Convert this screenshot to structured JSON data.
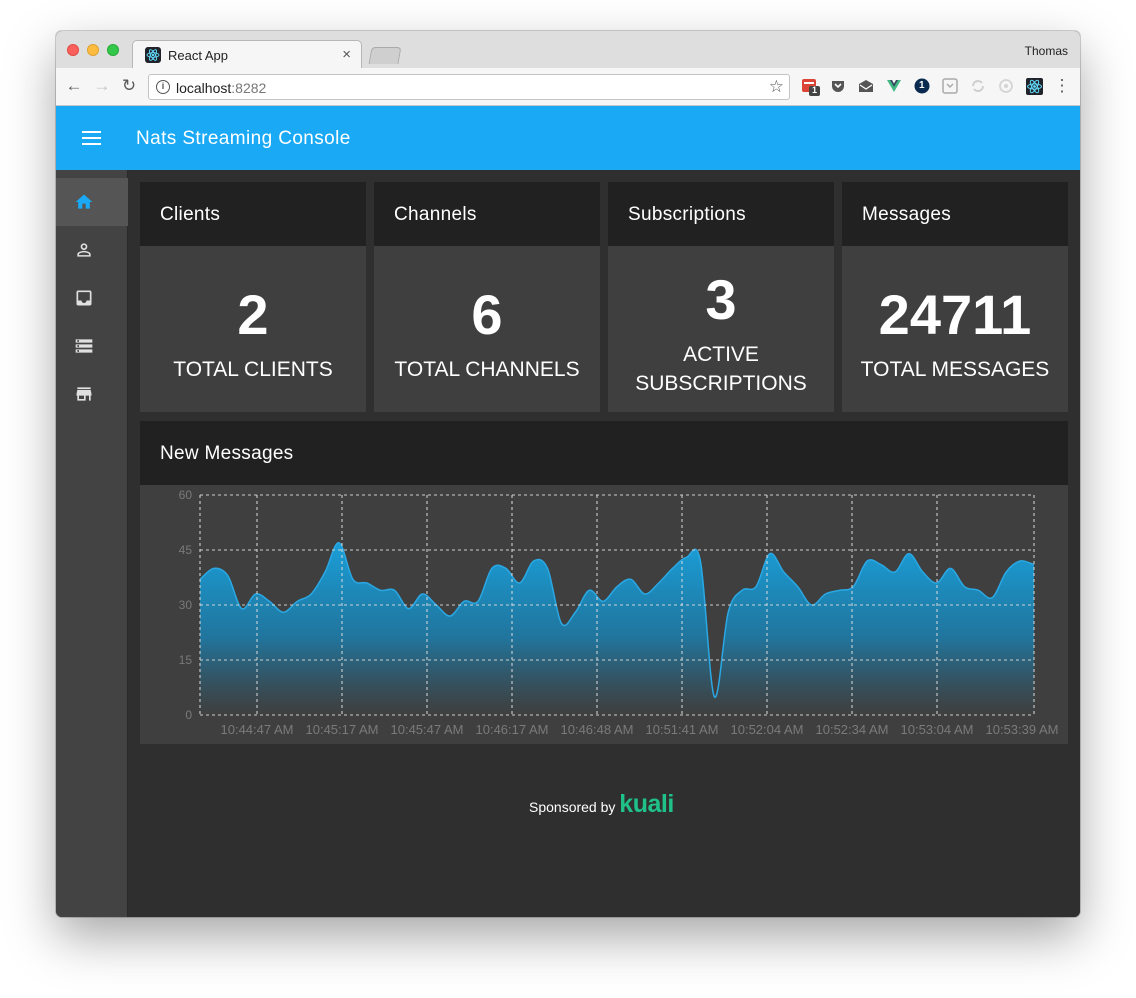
{
  "browser": {
    "tab_title": "React App",
    "tab_close": "×",
    "profile_name": "Thomas",
    "url_host": "localhost",
    "url_port": ":8282",
    "info_glyph": "i",
    "back_glyph": "←",
    "forward_glyph": "→",
    "reload_glyph": "↻",
    "star_glyph": "☆",
    "ext_badge": "1",
    "ext_onepass": "1",
    "ext_menu": "⋮"
  },
  "app": {
    "title": "Nats Streaming Console",
    "accent": "#19a9f5",
    "sidebar": [
      {
        "icon": "home-icon",
        "active": true
      },
      {
        "icon": "person-icon",
        "active": false
      },
      {
        "icon": "inbox-icon",
        "active": false
      },
      {
        "icon": "storage-icon",
        "active": false
      },
      {
        "icon": "store-icon",
        "active": false
      }
    ]
  },
  "cards": [
    {
      "title": "Clients",
      "value": "2",
      "label": "TOTAL CLIENTS"
    },
    {
      "title": "Channels",
      "value": "6",
      "label": "TOTAL CHANNELS"
    },
    {
      "title": "Subscriptions",
      "value": "3",
      "label_line1": "ACTIVE",
      "label_line2": "SUBSCRIPTIONS"
    },
    {
      "title": "Messages",
      "value": "24711",
      "label": "TOTAL MESSAGES"
    }
  ],
  "chart_title": "New Messages",
  "chart_data": {
    "type": "area",
    "ylim": [
      0,
      60
    ],
    "yticks": [
      "0",
      "15",
      "30",
      "45",
      "60"
    ],
    "grid": true,
    "color": "#1a9fd9",
    "xticks": [
      "10:44:47 AM",
      "10:45:17 AM",
      "10:45:47 AM",
      "10:46:17 AM",
      "10:46:48 AM",
      "10:51:41 AM",
      "10:52:04 AM",
      "10:52:34 AM",
      "10:53:04 AM",
      "10:53:39 AM"
    ],
    "values": [
      37,
      40,
      38,
      29,
      33,
      31,
      28,
      31,
      33,
      39,
      47,
      37,
      36,
      34,
      34,
      29,
      33,
      30,
      27,
      31,
      31,
      40,
      40,
      36,
      42,
      40,
      25,
      28,
      34,
      31,
      35,
      37,
      33,
      36,
      40,
      43,
      42,
      5,
      28,
      34,
      35,
      44,
      39,
      35,
      30,
      33,
      34,
      35,
      42,
      41,
      39,
      44,
      39,
      36,
      40,
      35,
      34,
      32,
      39,
      42,
      41
    ]
  },
  "sponsor": {
    "text": "Sponsored by ",
    "brand": "kuali",
    "brand_color": "#1fc189"
  }
}
